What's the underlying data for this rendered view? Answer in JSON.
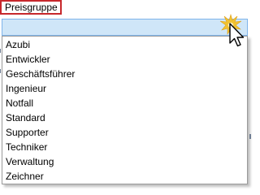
{
  "field": {
    "label": "Preisgruppe"
  },
  "dropdown": {
    "options": [
      "Azubi",
      "Entwickler",
      "Geschäftsführer",
      "Ingenieur",
      "Notfall",
      "Standard",
      "Supporter",
      "Techniker",
      "Verwaltung",
      "Zeichner"
    ]
  },
  "colors": {
    "label_outline": "#c7282c",
    "combo_fill": "#cfe6f8",
    "combo_border": "#7eb4ea",
    "click_burst": "#f1c232"
  },
  "icons": {
    "cursor": "mouse-pointer-icon",
    "click": "click-burst-icon"
  }
}
